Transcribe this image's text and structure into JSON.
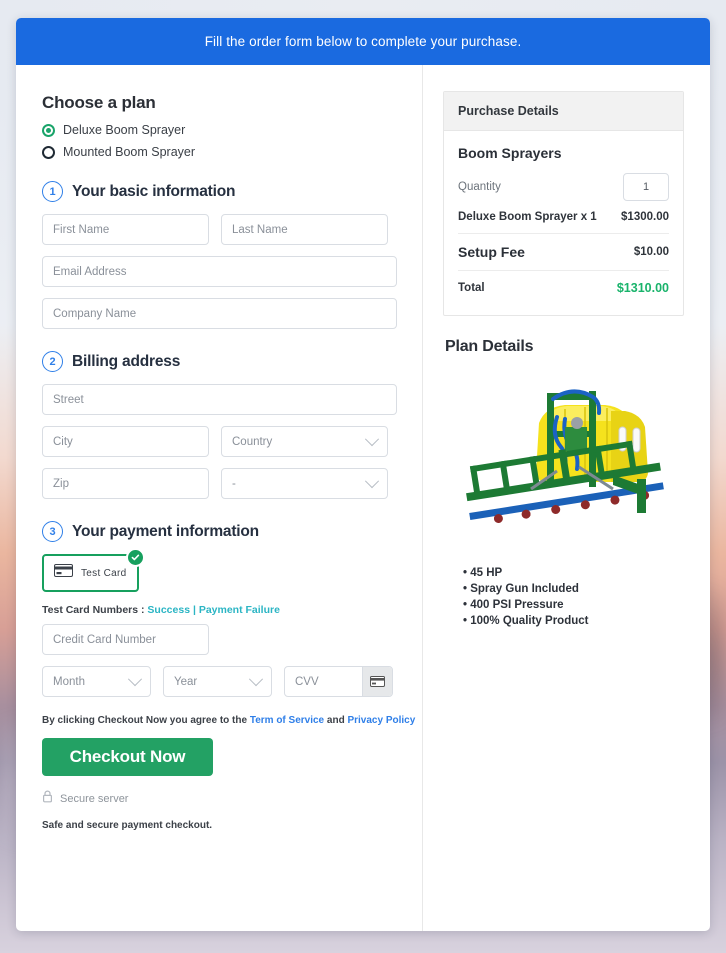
{
  "banner": {
    "text": "Fill the order form below to complete your purchase."
  },
  "plan": {
    "heading": "Choose a plan",
    "options": [
      {
        "label": "Deluxe Boom Sprayer",
        "selected": true
      },
      {
        "label": "Mounted Boom Sprayer",
        "selected": false
      }
    ]
  },
  "step1": {
    "number": "1",
    "title": "Your basic information",
    "fields": {
      "first_name": "First Name",
      "last_name": "Last Name",
      "email": "Email Address",
      "company": "Company Name"
    }
  },
  "step2": {
    "number": "2",
    "title": "Billing address",
    "fields": {
      "street": "Street",
      "city": "City",
      "country": "Country",
      "zip": "Zip",
      "state": "-"
    }
  },
  "step3": {
    "number": "3",
    "title": "Your payment information",
    "tab_label": "Test  Card",
    "test_card_prefix": "Test Card Numbers : ",
    "test_card_success": "Success",
    "test_card_separator": " | ",
    "test_card_failure": "Payment Failure",
    "fields": {
      "card_number": "Credit Card Number",
      "month": "Month",
      "year": "Year",
      "cvv": "CVV"
    }
  },
  "footer": {
    "terms_prefix": "By clicking Checkout Now you agree to the ",
    "terms_link": "Term of Service",
    "terms_and": " and ",
    "privacy_link": "Privacy Policy",
    "checkout_label": "Checkout Now",
    "secure_server": "Secure server",
    "safe_note": "Safe and secure payment checkout."
  },
  "purchase": {
    "header": "Purchase Details",
    "product_title": "Boom Sprayers",
    "quantity_label": "Quantity",
    "quantity_value": "1",
    "line_item": "Deluxe Boom Sprayer x 1",
    "line_amount": "$1300.00",
    "setup_fee_label": "Setup Fee",
    "setup_fee_amount": "$10.00",
    "total_label": "Total",
    "total_amount": "$1310.00"
  },
  "plan_details": {
    "heading": "Plan Details",
    "image_alt": "boom-sprayer-product-photo",
    "features": [
      "45 HP",
      "Spray Gun Included",
      "400 PSI Pressure",
      "100% Quality Product"
    ]
  },
  "colors": {
    "banner_blue": "#1a6ae0",
    "accent_green": "#23a164",
    "selected_radio": "#1aa46a",
    "link_teal": "#2bb5c4",
    "link_blue": "#2f7fe8",
    "total_green": "#19b36b"
  }
}
